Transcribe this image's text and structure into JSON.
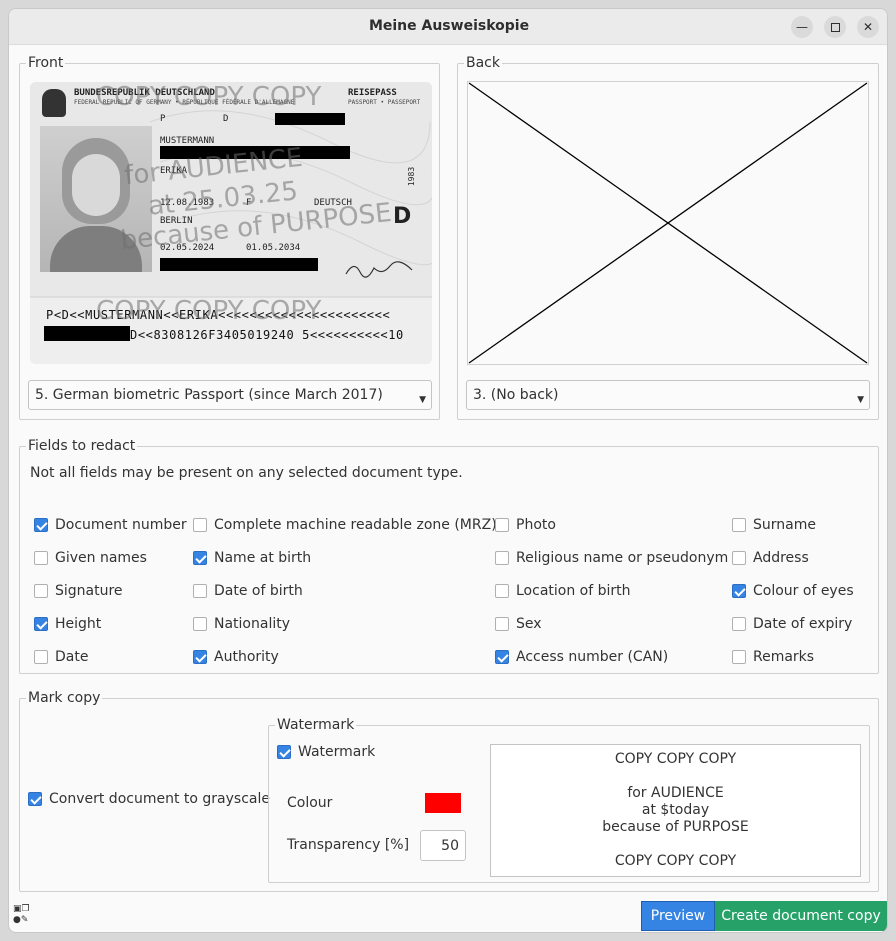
{
  "window": {
    "title": "Meine Ausweiskopie",
    "minimize_icon": "minimize-icon",
    "maximize_icon": "maximize-icon",
    "close_icon": "close-icon"
  },
  "front": {
    "group_title": "Front",
    "document_type": "5. German biometric Passport (since March 2017)",
    "passport": {
      "header_line1": "BUNDESREPUBLIK DEUTSCHLAND",
      "header_line2": "FEDERAL REPUBLIC OF GERMANY • RÉPUBLIQUE FÉDÉRALE D'ALLEMAGNE",
      "doc_label": "REISEPASS",
      "doc_label_sub": "PASSPORT • PASSEPORT",
      "type_code": "P",
      "country_code": "D",
      "surname": "MUSTERMANN",
      "given_name": "ERIKA",
      "birth_date": "12.08.1983",
      "sex": "F",
      "nationality": "DEUTSCH",
      "birth_place": "BERLIN",
      "issue_date": "02.05.2024",
      "expiry_date": "01.05.2034",
      "year_stamp": "1983",
      "country_letter": "D",
      "mrz_line1": "P<D<<MUSTERMANN<<ERIKA<<<<<<<<<<<<<<<<<<<<<<",
      "mrz_line2": "D<<8308126F3405019240 5<<<<<<<<<<10",
      "watermark_copy": "COPY COPY COPY",
      "watermark_for": "for AUDIENCE",
      "watermark_at": "at 25.03.25",
      "watermark_because": "because of PURPOSE"
    }
  },
  "back": {
    "group_title": "Back",
    "document_type": "3. (No back)"
  },
  "fields": {
    "group_title": "Fields to redact",
    "hint": "Not all fields may be present on any selected document type.",
    "items": [
      {
        "label": "Document number",
        "checked": true
      },
      {
        "label": "Complete machine readable zone (MRZ)",
        "checked": false
      },
      {
        "label": "Photo",
        "checked": false
      },
      {
        "label": "Surname",
        "checked": false
      },
      {
        "label": "Given names",
        "checked": false
      },
      {
        "label": "Name at birth",
        "checked": true
      },
      {
        "label": "Religious name or pseudonym",
        "checked": false
      },
      {
        "label": "Address",
        "checked": false
      },
      {
        "label": "Signature",
        "checked": false
      },
      {
        "label": "Date of birth",
        "checked": false
      },
      {
        "label": "Location of birth",
        "checked": false
      },
      {
        "label": "Colour of eyes",
        "checked": true
      },
      {
        "label": "Height",
        "checked": true
      },
      {
        "label": "Nationality",
        "checked": false
      },
      {
        "label": "Sex",
        "checked": false
      },
      {
        "label": "Date of expiry",
        "checked": false
      },
      {
        "label": "Date",
        "checked": false
      },
      {
        "label": "Authority",
        "checked": true
      },
      {
        "label": "Access number (CAN)",
        "checked": true
      },
      {
        "label": "Remarks",
        "checked": false
      }
    ]
  },
  "mark_copy": {
    "group_title": "Mark copy",
    "grayscale_label": "Convert document to grayscale",
    "grayscale_checked": true,
    "watermark_group_title": "Watermark",
    "watermark_label": "Watermark",
    "watermark_checked": true,
    "colour_label": "Colour",
    "colour_value": "#ff0000",
    "transparency_label": "Transparency [%]",
    "transparency_value": "50",
    "watermark_text": [
      "COPY COPY COPY",
      "",
      "for AUDIENCE",
      "at $today",
      "because of PURPOSE",
      "",
      "COPY COPY COPY"
    ]
  },
  "footer": {
    "preview_label": "Preview",
    "create_label": "Create document copy",
    "preview_color": "#3584e4",
    "create_color": "#26a269",
    "status_icons": [
      "lock-icon",
      "copy-icon",
      "user-lock-icon",
      "user-edit-icon"
    ]
  }
}
